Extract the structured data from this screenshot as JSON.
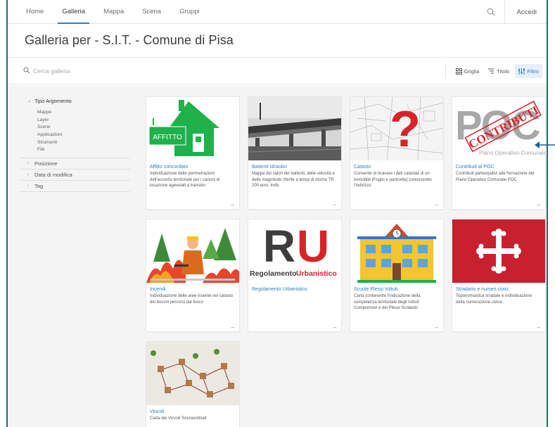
{
  "nav": {
    "items": [
      "Home",
      "Galleria",
      "Mappa",
      "Scena",
      "Gruppi"
    ],
    "signin": "Accedi"
  },
  "page": {
    "title": "Galleria per - S.I.T. - Comune di Pisa"
  },
  "search": {
    "placeholder": "Cerca galleria"
  },
  "views": {
    "grid": "Griglia",
    "title": "Titolo",
    "filter": "Filtro"
  },
  "sidebar": {
    "tipo": {
      "label": "Tipo Argomento",
      "options": [
        "Mappe",
        "Layer",
        "Scene",
        "Applicazioni",
        "Strumenti",
        "File"
      ]
    },
    "posizione": "Posizione",
    "data": "Data di modifica",
    "tag": "Tag"
  },
  "cards": [
    {
      "title": "Affitto concordato",
      "desc": "Individuazione delle perimetrazioni dell'accordo territoriale per i canoni di locazione agevolati a transitor",
      "thumb_text": "AFFITTO"
    },
    {
      "title": "Battenti Idraulici",
      "desc": "Mappa dei valori dei battenti, delle velocità e delle magnitudo riferite a tempi di ritorno TR 200 anni. Indic"
    },
    {
      "title": "Catasto",
      "desc": "Consente di ricavare i dati catastali di un immobile (Foglio e particella) conoscendo l'indirizzo"
    },
    {
      "title": "Contributi al POC",
      "desc": "Contributi partecipativi alla formazione del Piano Operativo Comunale POC",
      "thumb_text": "POC",
      "thumb_sub": "Piano Operativo Comunale",
      "stamp": "CONTRIBUTI"
    },
    {
      "title": "Incendi",
      "desc": "Individuazione delle aree inserite nel catasto dei boschi percorsi dal fuoco"
    },
    {
      "title": "Regolamento Urbanistico",
      "desc": "",
      "thumb_text": "RU",
      "thumb_sub1": "Regolamento",
      "thumb_sub2": "Urbanistico"
    },
    {
      "title": "Scuole Plessi Istituti",
      "desc": "Carta contenente l'indicazione della competenza territoriale degli Istituti Comprensivi e dei Plessi Scolastic"
    },
    {
      "title": "Stradario e numeri civici",
      "desc": "Toponomastica stradale e individuazione della numerazione civica"
    },
    {
      "title": "Vincoli",
      "desc": "Carta dei Vincoli Sovraordinati"
    }
  ],
  "more_label": "...",
  "colors": {
    "accent": "#2b7fbf",
    "green": "#1fb14a",
    "red": "#d8232a",
    "pisa_red": "#c8202e"
  }
}
